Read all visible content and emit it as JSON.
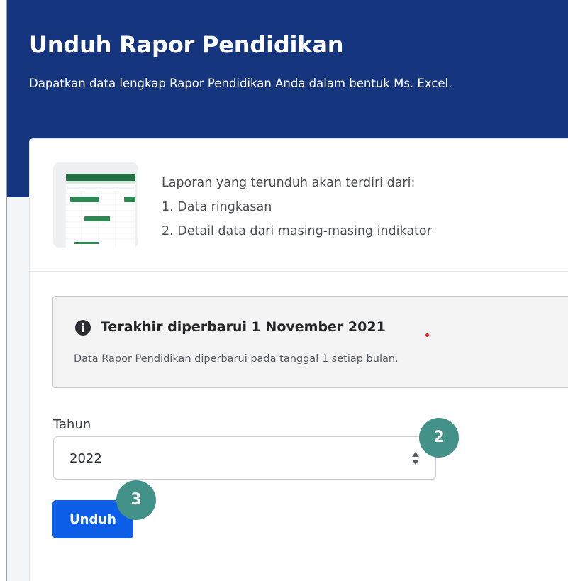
{
  "header": {
    "title": "Unduh Rapor Pendidikan",
    "subtitle": "Dapatkan data lengkap Rapor Pendidikan Anda dalam bentuk Ms. Excel."
  },
  "report_info": {
    "thumbnail_icon": "excel-spreadsheet-thumbnail",
    "intro": "Laporan yang terunduh akan terdiri dari:",
    "items": [
      "1. Data ringkasan",
      "2. Detail data dari masing-masing indikator"
    ]
  },
  "alert": {
    "icon": "info-icon",
    "title": "Terakhir diperbarui 1 November 2021",
    "description": "Data Rapor Pendidikan diperbarui pada tanggal 1 setiap bulan."
  },
  "form": {
    "year_label": "Tahun",
    "year_value": "2022",
    "download_label": "Unduh"
  },
  "annotations": {
    "step_2": "2",
    "step_3": "3"
  },
  "colors": {
    "header_bg": "#16357f",
    "button_bg": "#0d5ee9",
    "badge_bg": "#43928a",
    "alert_bg": "#f3f3f3"
  }
}
